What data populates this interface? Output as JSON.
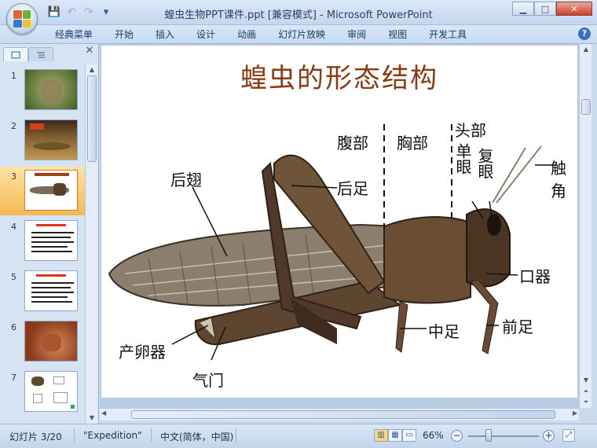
{
  "window": {
    "title": "蝗虫生物PPT课件.ppt [兼容模式] - Microsoft PowerPoint",
    "minimize": "▁",
    "maximize": "□",
    "close": "✕"
  },
  "qat": {
    "save_icon": "💾",
    "undo_icon": "↶",
    "redo_icon": "↷",
    "more_icon": "▾"
  },
  "ribbon": {
    "tabs": [
      "经典菜单",
      "开始",
      "插入",
      "设计",
      "动画",
      "幻灯片放映",
      "审阅",
      "视图",
      "开发工具"
    ],
    "help": "?"
  },
  "slides_pane": {
    "close": "✕",
    "selected_index": 3,
    "thumbnails": [
      {
        "num": "1",
        "kind": "photo-green"
      },
      {
        "num": "2",
        "kind": "photo-brown"
      },
      {
        "num": "3",
        "kind": "diagram"
      },
      {
        "num": "4",
        "kind": "text"
      },
      {
        "num": "5",
        "kind": "text"
      },
      {
        "num": "6",
        "kind": "photo-red"
      },
      {
        "num": "7",
        "kind": "diagram-small"
      }
    ]
  },
  "slide": {
    "title": "蝗虫的形态结构",
    "labels": {
      "abdomen": "腹部",
      "thorax": "胸部",
      "head": "头部",
      "ocellus": "单眼",
      "compound_eye": "复眼",
      "antenna": "触角",
      "hind_wing": "后翅",
      "hind_leg": "后足",
      "mouthparts": "口器",
      "ovipositor": "产卵器",
      "middle_leg": "中足",
      "front_leg": "前足",
      "spiracle": "气门"
    }
  },
  "status": {
    "slide_info": "幻灯片 3/20",
    "theme": "\"Expedition\"",
    "language": "中文(简体，中国)",
    "zoom": "66%",
    "zoom_out": "−",
    "zoom_in": "+",
    "zoom_fraction": 0.66
  }
}
